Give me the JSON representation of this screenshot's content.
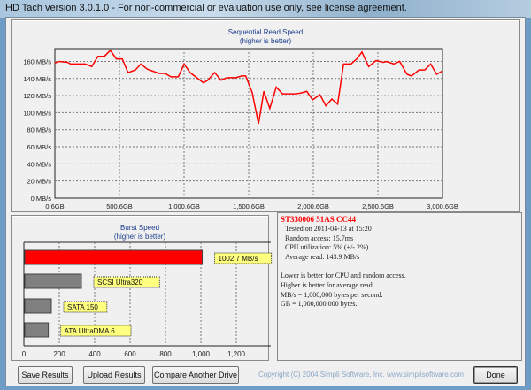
{
  "window": {
    "title": "HD Tach version 3.0.1.0  - For non-commercial or evaluation use only, see license agreement."
  },
  "chart_data": [
    {
      "type": "line",
      "title": "Sequential Read Speed",
      "subtitle": "(higher is better)",
      "xlim": [
        0.6,
        3000.6
      ],
      "ylim": [
        0,
        175
      ],
      "grid": true,
      "color": "#ff0000",
      "xticks": [
        "0.6GB",
        "500.6GB",
        "1,000.6GB",
        "1,500.6GB",
        "2,000.6GB",
        "2,500.6GB",
        "3,000.6GB"
      ],
      "yticks": [
        "0 MB/s",
        "20 MB/s",
        "40 MB/s",
        "60 MB/s",
        "80 MB/s",
        "100 MB/s",
        "120 MB/s",
        "140 MB/s",
        "160 MB/s"
      ],
      "x": [
        0.6,
        30,
        99,
        122,
        236,
        286,
        334,
        384,
        430,
        476,
        522,
        567,
        624,
        666,
        716,
        807,
        853,
        899,
        956,
        1001,
        1047,
        1150,
        1184,
        1237,
        1287,
        1333,
        1401,
        1447,
        1477,
        1527,
        1577,
        1618,
        1664,
        1714,
        1762,
        1858,
        1904,
        1950,
        1995,
        2052,
        2098,
        2144,
        2189,
        2235,
        2292,
        2338,
        2377,
        2429,
        2486,
        2544,
        2566,
        2623,
        2669,
        2726,
        2761,
        2818,
        2863,
        2909,
        2955,
        3000.6
      ],
      "y": [
        158,
        160,
        159,
        157,
        157,
        154,
        166,
        166,
        173,
        163,
        163,
        147,
        150,
        157,
        151,
        146,
        146,
        142,
        142,
        157,
        147,
        135,
        138,
        147,
        138,
        141,
        141,
        143,
        143,
        124,
        87,
        125,
        105,
        130,
        122,
        122,
        123,
        125,
        115,
        121,
        108,
        116,
        110,
        157,
        157,
        163,
        171,
        154,
        161,
        159,
        160,
        157,
        160,
        145,
        143,
        150,
        150,
        157,
        145,
        149
      ]
    },
    {
      "type": "bar",
      "orientation": "horizontal",
      "title": "Burst Speed",
      "subtitle": "(higher is better)",
      "xlim": [
        0,
        1400
      ],
      "grid": true,
      "xticks": [
        "0",
        "200",
        "400",
        "600",
        "800",
        "1,000",
        "1,200"
      ],
      "bars": [
        {
          "label": "1002.7 MB/s",
          "value": 1002.7,
          "color": "#ff0000"
        },
        {
          "label": "SCSI Ultra320",
          "value": 320,
          "color": "#808080"
        },
        {
          "label": "SATA 150",
          "value": 150,
          "color": "#808080"
        },
        {
          "label": "ATA UltraDMA 6",
          "value": 133,
          "color": "#808080"
        }
      ]
    }
  ],
  "info": {
    "drive": "ST330006 51AS CC44",
    "tested": "Tested on 2011-04-13 at 15:20",
    "random": "Random access: 15.7ms",
    "cpu": "CPU utilization: 5% (+/- 2%)",
    "avg": "Average read: 143.9 MB/s",
    "notes": [
      "Lower is better for CPU and random access.",
      "Higher is better for average read.",
      "MB/s = 1,000,000 bytes per second.",
      "GB = 1,000,000,000 bytes."
    ]
  },
  "buttons": {
    "save": "Save Results",
    "upload": "Upload Results",
    "compare": "Compare Another Drive",
    "done": "Done"
  },
  "copyright": "Copyright (C) 2004 Simpli Software, Inc. www.simplisoftware.com"
}
